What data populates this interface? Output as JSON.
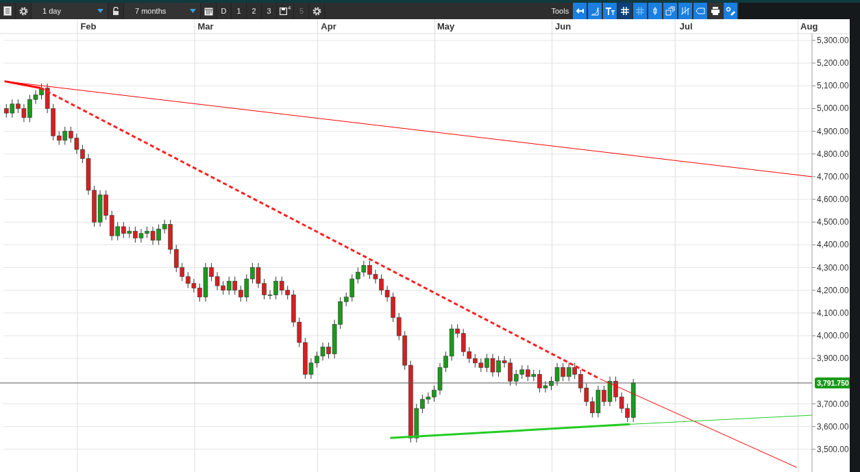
{
  "toolbar": {
    "interval": "1 day",
    "range": "7 months",
    "periods": [
      {
        "label": "D",
        "disabled": false
      },
      {
        "label": "1",
        "disabled": false
      },
      {
        "label": "2",
        "disabled": false
      },
      {
        "label": "3",
        "disabled": false
      },
      {
        "label": "5",
        "disabled": true
      }
    ],
    "save_badge": "4",
    "tools_label": "Tools",
    "tools": [
      {
        "kind": "back",
        "selected": false
      },
      {
        "kind": "curve",
        "selected": false
      },
      {
        "kind": "text",
        "selected": false
      },
      {
        "kind": "grid",
        "selected": true
      },
      {
        "kind": "draw",
        "selected": false
      },
      {
        "kind": "candle",
        "selected": false
      },
      {
        "kind": "windows",
        "selected": false
      },
      {
        "kind": "bars",
        "selected": false
      },
      {
        "kind": "tag",
        "selected": false
      },
      {
        "kind": "print",
        "selected": false
      },
      {
        "kind": "settings",
        "selected": false
      }
    ]
  },
  "chart": {
    "last_price": "3,791.750",
    "chart_data": {
      "type": "candlestick",
      "ylim": [
        3400,
        5330
      ],
      "grid": true,
      "categories": [
        null,
        null,
        null,
        null,
        null,
        null,
        null,
        null,
        null,
        null,
        null,
        null,
        null,
        null,
        "Feb",
        null,
        null,
        null,
        null,
        null,
        null,
        null,
        null,
        null,
        null,
        null,
        null,
        null,
        null,
        null,
        null,
        null,
        null,
        null,
        "Mar",
        null,
        null,
        null,
        null,
        null,
        null,
        null,
        null,
        null,
        null,
        null,
        null,
        null,
        null,
        null,
        null,
        null,
        null,
        null,
        null,
        "Apr",
        null,
        null,
        null,
        null,
        null,
        null,
        null,
        null,
        null,
        null,
        null,
        null,
        null,
        null,
        null,
        null,
        null,
        null,
        null,
        "May",
        null,
        null,
        null,
        null,
        null,
        null,
        null,
        null,
        null,
        null,
        null,
        null,
        null,
        null,
        null,
        null,
        null,
        null,
        null,
        "Jun",
        null,
        null,
        null,
        null,
        null,
        null,
        null,
        null,
        null,
        null,
        null,
        null,
        null,
        null,
        null,
        null,
        null,
        null,
        null,
        null,
        "Jul",
        null,
        null,
        null,
        null,
        null,
        null,
        null,
        null,
        null,
        null,
        null,
        null,
        null,
        null,
        null,
        null,
        null,
        null,
        null,
        null,
        "Aug"
      ],
      "yticks": [
        {
          "value": 5300,
          "label": "5,300.00"
        },
        {
          "value": 5200,
          "label": "5,200.00"
        },
        {
          "value": 5100,
          "label": "5,100.00"
        },
        {
          "value": 5000,
          "label": "5,000.00"
        },
        {
          "value": 4900,
          "label": "4,900.00"
        },
        {
          "value": 4800,
          "label": "4,800.00"
        },
        {
          "value": 4700,
          "label": "4,700.00"
        },
        {
          "value": 4600,
          "label": "4,600.00"
        },
        {
          "value": 4500,
          "label": "4,500.00"
        },
        {
          "value": 4400,
          "label": "4,400.00"
        },
        {
          "value": 4300,
          "label": "4,300.00"
        },
        {
          "value": 4200,
          "label": "4,200.00"
        },
        {
          "value": 4100,
          "label": "4,100.00"
        },
        {
          "value": 4000,
          "label": "4,000.00"
        },
        {
          "value": 3900,
          "label": "3,900.00"
        },
        {
          "value": 3700,
          "label": "3,700.00"
        },
        {
          "value": 3600,
          "label": "3,600.00"
        },
        {
          "value": 3500,
          "label": "3,500.00"
        }
      ],
      "ohlc": [
        [
          5000,
          5020,
          4960,
          4980
        ],
        [
          4980,
          5040,
          4960,
          5020
        ],
        [
          5020,
          5040,
          4980,
          5000
        ],
        [
          5000,
          5020,
          4940,
          4960
        ],
        [
          4960,
          5060,
          4940,
          5040
        ],
        [
          5040,
          5080,
          5020,
          5060
        ],
        [
          5060,
          5110,
          5040,
          5090
        ],
        [
          5090,
          5110,
          4980,
          5000
        ],
        [
          5000,
          5020,
          4860,
          4880
        ],
        [
          4880,
          4900,
          4840,
          4860
        ],
        [
          4860,
          4920,
          4840,
          4900
        ],
        [
          4900,
          4920,
          4850,
          4870
        ],
        [
          4870,
          4890,
          4800,
          4820
        ],
        [
          4820,
          4840,
          4760,
          4780
        ],
        [
          4780,
          4800,
          4620,
          4640
        ],
        [
          4640,
          4660,
          4480,
          4500
        ],
        [
          4500,
          4640,
          4480,
          4620
        ],
        [
          4620,
          4640,
          4510,
          4530
        ],
        [
          4530,
          4550,
          4420,
          4440
        ],
        [
          4440,
          4500,
          4420,
          4480
        ],
        [
          4480,
          4500,
          4430,
          4450
        ],
        [
          4450,
          4480,
          4430,
          4460
        ],
        [
          4460,
          4480,
          4410,
          4430
        ],
        [
          4430,
          4470,
          4410,
          4450
        ],
        [
          4450,
          4480,
          4430,
          4460
        ],
        [
          4460,
          4480,
          4400,
          4420
        ],
        [
          4420,
          4490,
          4400,
          4470
        ],
        [
          4470,
          4510,
          4450,
          4490
        ],
        [
          4490,
          4510,
          4360,
          4380
        ],
        [
          4380,
          4400,
          4280,
          4300
        ],
        [
          4300,
          4320,
          4240,
          4260
        ],
        [
          4260,
          4280,
          4210,
          4230
        ],
        [
          4230,
          4250,
          4190,
          4210
        ],
        [
          4210,
          4230,
          4150,
          4170
        ],
        [
          4170,
          4320,
          4150,
          4300
        ],
        [
          4300,
          4320,
          4240,
          4260
        ],
        [
          4260,
          4280,
          4200,
          4220
        ],
        [
          4220,
          4240,
          4180,
          4200
        ],
        [
          4200,
          4260,
          4180,
          4240
        ],
        [
          4240,
          4260,
          4180,
          4200
        ],
        [
          4200,
          4220,
          4150,
          4170
        ],
        [
          4170,
          4270,
          4150,
          4250
        ],
        [
          4250,
          4320,
          4230,
          4300
        ],
        [
          4300,
          4320,
          4210,
          4230
        ],
        [
          4230,
          4250,
          4160,
          4180
        ],
        [
          4180,
          4200,
          4160,
          4180
        ],
        [
          4180,
          4260,
          4160,
          4240
        ],
        [
          4240,
          4260,
          4180,
          4200
        ],
        [
          4200,
          4220,
          4160,
          4180
        ],
        [
          4180,
          4200,
          4040,
          4060
        ],
        [
          4060,
          4080,
          3950,
          3970
        ],
        [
          3970,
          3990,
          3810,
          3830
        ],
        [
          3830,
          3900,
          3810,
          3880
        ],
        [
          3880,
          3930,
          3860,
          3910
        ],
        [
          3910,
          3970,
          3890,
          3950
        ],
        [
          3950,
          3970,
          3900,
          3920
        ],
        [
          3920,
          4070,
          3900,
          4050
        ],
        [
          4050,
          4170,
          4030,
          4150
        ],
        [
          4150,
          4190,
          4130,
          4170
        ],
        [
          4170,
          4270,
          4150,
          4250
        ],
        [
          4250,
          4300,
          4230,
          4280
        ],
        [
          4280,
          4330,
          4260,
          4310
        ],
        [
          4310,
          4330,
          4250,
          4270
        ],
        [
          4270,
          4290,
          4230,
          4250
        ],
        [
          4250,
          4270,
          4180,
          4200
        ],
        [
          4200,
          4220,
          4150,
          4170
        ],
        [
          4170,
          4190,
          4060,
          4080
        ],
        [
          4080,
          4100,
          3980,
          4000
        ],
        [
          4000,
          4020,
          3850,
          3870
        ],
        [
          3870,
          3890,
          3530,
          3550
        ],
        [
          3550,
          3700,
          3530,
          3680
        ],
        [
          3680,
          3740,
          3660,
          3720
        ],
        [
          3720,
          3750,
          3700,
          3730
        ],
        [
          3730,
          3780,
          3710,
          3760
        ],
        [
          3760,
          3880,
          3740,
          3860
        ],
        [
          3860,
          3930,
          3840,
          3910
        ],
        [
          3910,
          4050,
          3890,
          4030
        ],
        [
          4030,
          4050,
          3990,
          4010
        ],
        [
          4010,
          4030,
          3910,
          3930
        ],
        [
          3930,
          3950,
          3880,
          3900
        ],
        [
          3900,
          3920,
          3860,
          3880
        ],
        [
          3880,
          3900,
          3840,
          3860
        ],
        [
          3860,
          3920,
          3840,
          3900
        ],
        [
          3900,
          3920,
          3820,
          3840
        ],
        [
          3840,
          3910,
          3820,
          3890
        ],
        [
          3890,
          3910,
          3860,
          3880
        ],
        [
          3880,
          3900,
          3780,
          3800
        ],
        [
          3800,
          3850,
          3780,
          3830
        ],
        [
          3830,
          3870,
          3810,
          3850
        ],
        [
          3850,
          3870,
          3800,
          3820
        ],
        [
          3820,
          3850,
          3800,
          3830
        ],
        [
          3830,
          3850,
          3750,
          3770
        ],
        [
          3770,
          3800,
          3750,
          3780
        ],
        [
          3780,
          3820,
          3760,
          3800
        ],
        [
          3800,
          3880,
          3780,
          3860
        ],
        [
          3860,
          3880,
          3800,
          3820
        ],
        [
          3820,
          3880,
          3800,
          3860
        ],
        [
          3860,
          3880,
          3810,
          3830
        ],
        [
          3830,
          3850,
          3750,
          3770
        ],
        [
          3770,
          3790,
          3690,
          3710
        ],
        [
          3710,
          3730,
          3640,
          3660
        ],
        [
          3660,
          3780,
          3640,
          3760
        ],
        [
          3760,
          3780,
          3690,
          3710
        ],
        [
          3710,
          3820,
          3690,
          3800
        ],
        [
          3800,
          3820,
          3710,
          3730
        ],
        [
          3730,
          3750,
          3660,
          3680
        ],
        [
          3680,
          3700,
          3620,
          3640
        ],
        [
          3640,
          3810,
          3620,
          3792
        ],
        null,
        null,
        null,
        null,
        null,
        null,
        null,
        null,
        null,
        null,
        null,
        null,
        null,
        null,
        null,
        null,
        null,
        null,
        null,
        null,
        null,
        null,
        null,
        null,
        null,
        null,
        null,
        null,
        null,
        null
      ]
    }
  }
}
